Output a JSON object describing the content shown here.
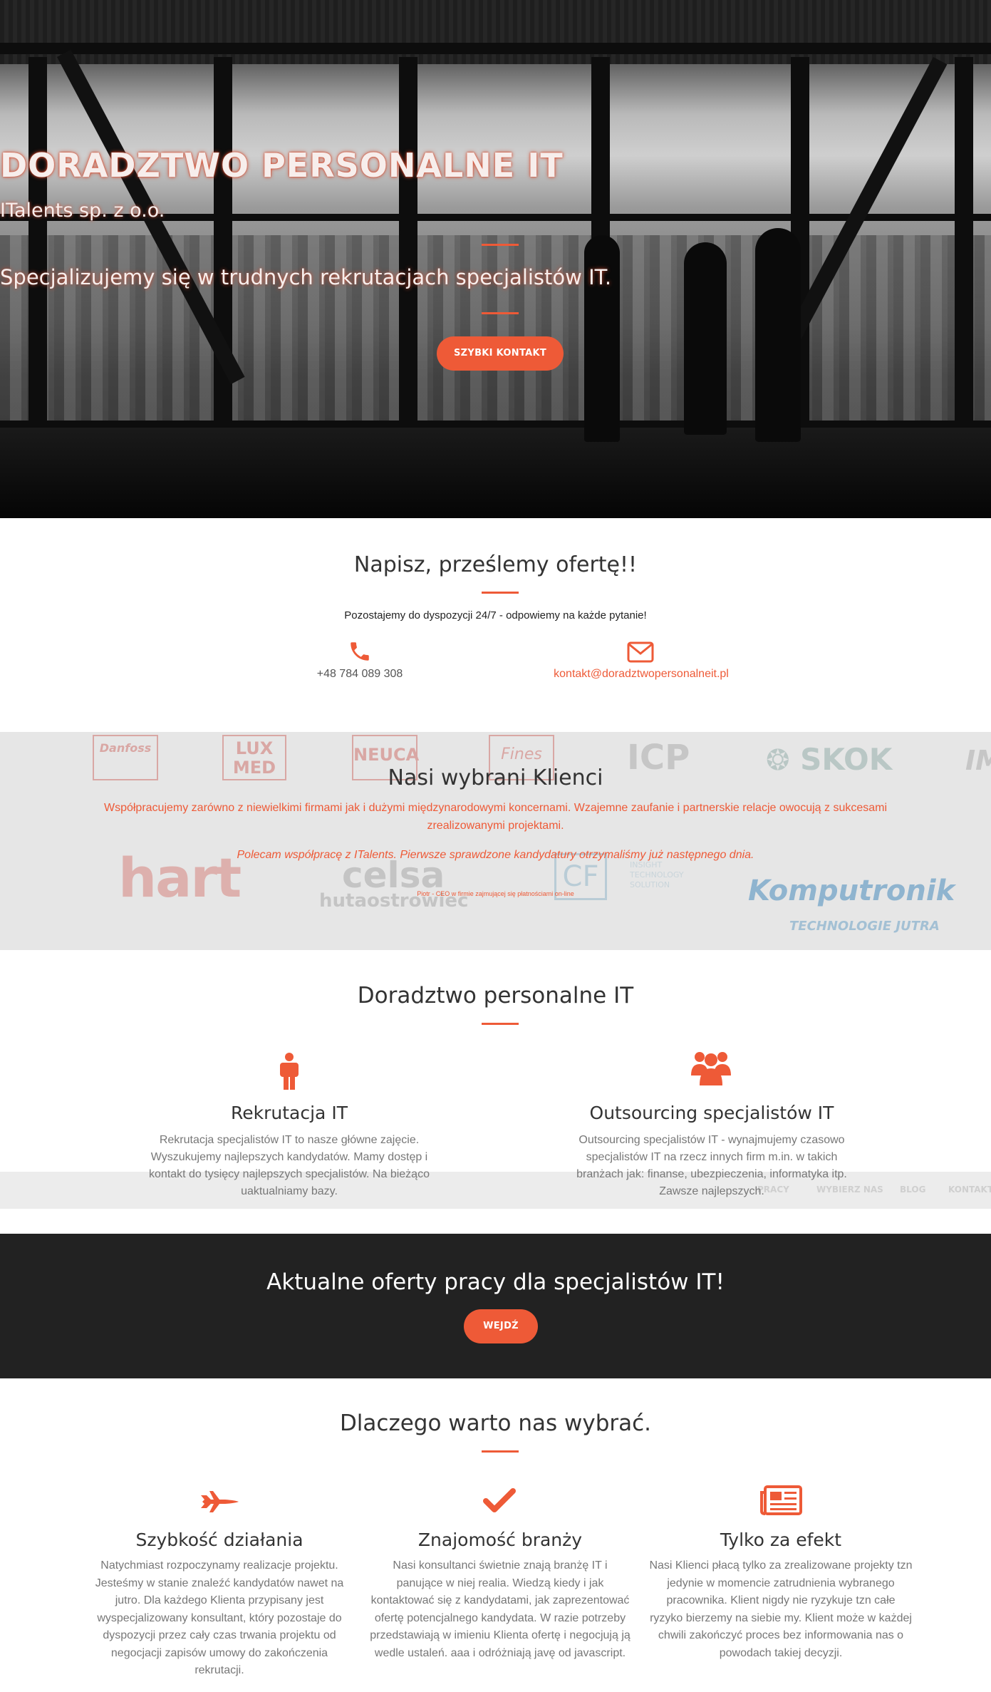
{
  "hero": {
    "title": "DORADZTWO PERSONALNE IT",
    "company": "ITalents sp. z o.o.",
    "tagline": "Specjalizujemy się w trudnych rekrutacjach specjalistów IT.",
    "button": "SZYBKI KONTAKT"
  },
  "contact": {
    "heading": "Napisz, prześlemy ofertę!!",
    "intro": "Pozostajemy do dyspozycji 24/7 - odpowiemy na każde pytanie!",
    "phone": "+48 784 089 308",
    "email": "kontakt@doradztwopersonalneit.pl",
    "phone_icon": "phone-icon",
    "email_icon": "envelope-icon"
  },
  "clients": {
    "heading": "Nasi wybrani Klienci",
    "description": "Współpracujemy zarówno z niewielkimi firmami jak i dużymi międzynarodowymi koncernami. Wzajemne zaufanie i partnerskie relacje owocują z sukcesami zrealizowanymi projektami.",
    "quote": "Polecam współpracę z ITalents. Pierwsze sprawdzone kandydatury otrzymaliśmy już następnego dnia.",
    "cite": "Piotr - CEO w firmie zajmującej się płatnościami on-line",
    "logos": {
      "danfoss": "Danfoss",
      "lux": "LUX",
      "med": "MED",
      "neuca": "NEUCA",
      "fines": "Fines",
      "icp": "ICP",
      "skok": "SKOK",
      "im": "IM",
      "hart": "hart",
      "celsa": "celsa",
      "huta": "hutaostrowiec",
      "cf": "CF",
      "insight": "INSIGHT TECHNOLOGY SOLUTION",
      "komputronik": "Komputronik",
      "komputronik_sub": "TECHNOLOGIE JUTRA"
    }
  },
  "services": {
    "heading": "Doradztwo personalne IT",
    "items": [
      {
        "title": "Rekrutacja IT",
        "text": "Rekrutacja specjalistów IT to nasze główne zajęcie. Wyszukujemy najlepszych kandydatów. Mamy dostęp i kontakt do tysięcy najlepszych specjalistów. Na bieżąco uaktualniamy bazy.",
        "icon": "person-icon"
      },
      {
        "title": "Outsourcing specjalistów IT",
        "text": "Outsourcing specjalistów IT - wynajmujemy czasowo specjalistów IT na rzecz innych firm m.in. w takich branżach jak: finanse, ubezpieczenia, informatyka itp. Zawsze najlepszych.",
        "icon": "group-icon"
      }
    ],
    "ghost_nav": [
      "PRACY",
      "WYBIERZ NAS",
      "BLOG",
      "KONTAKT"
    ]
  },
  "jobs": {
    "heading": "Aktualne oferty pracy dla specjalistów IT!",
    "button": "WEJDŹ"
  },
  "why": {
    "heading": "Dlaczego warto nas wybrać.",
    "items": [
      {
        "title": "Szybkość działania",
        "text": "Natychmiast rozpoczynamy realizacje projektu. Jesteśmy w stanie znaleźć kandydatów nawet na jutro. Dla każdego Klienta przypisany jest wyspecjalizowany konsultant, który pozostaje do dyspozycji przez cały czas trwania projektu od negocjacji zapisów umowy do zakończenia rekrutacji.",
        "icon": "fighter-jet-icon"
      },
      {
        "title": "Znajomość branży",
        "text": "Nasi konsultanci świetnie znają branżę IT i panujące w niej realia. Wiedzą kiedy i jak kontaktować się z kandydatami, jak zaprezentować ofertę potencjalnego kandydata. W razie potrzeby przedstawiają w imieniu Klienta ofertę i negocjują ją wedle ustaleń. aaa i odróżniają javę od javascript.",
        "icon": "check-icon"
      },
      {
        "title": "Tylko za efekt",
        "text": "Nasi Klienci płacą tylko za zrealizowane projekty tzn jedynie w momencie zatrudnienia wybranego pracownika. Klient nigdy nie ryzykuje tzn całe ryzyko bierzemy na siebie my. Klient może w każdej chwili zakończyć proces bez informowania nas o powodach takiej decyzji.",
        "icon": "newspaper-icon"
      }
    ]
  },
  "colors": {
    "accent": "#ee5a37",
    "dark": "#222222",
    "gray_band": "#e6e6e6"
  }
}
